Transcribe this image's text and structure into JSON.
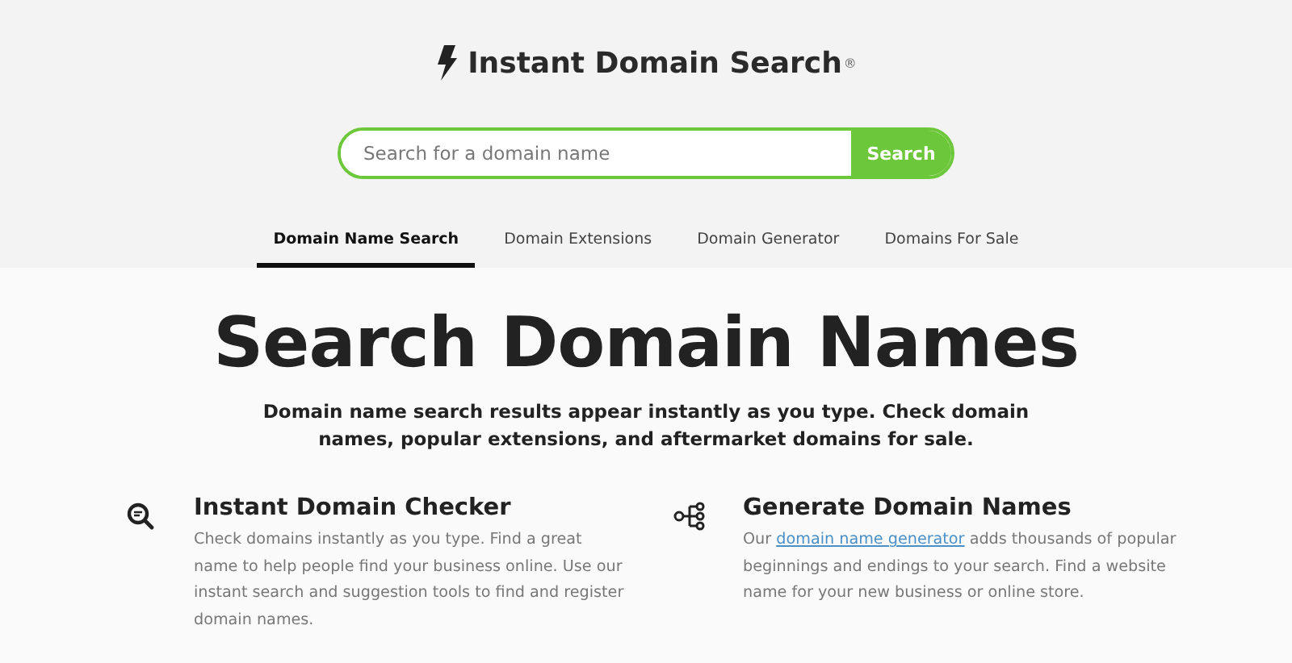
{
  "logo": {
    "text": "Instant Domain Search",
    "mark": "®"
  },
  "search": {
    "placeholder": "Search for a domain name",
    "button": "Search"
  },
  "tabs": [
    {
      "label": "Domain Name Search",
      "selected": true
    },
    {
      "label": "Domain Extensions",
      "selected": false
    },
    {
      "label": "Domain Generator",
      "selected": false
    },
    {
      "label": "Domains For Sale",
      "selected": false
    }
  ],
  "heading": "Search Domain Names",
  "intro": "Domain name search results appear instantly as you type. Check domain names, popular extensions, and aftermarket domains for sale.",
  "features": [
    {
      "kind": "checker",
      "title": "Instant Domain Checker",
      "description": [
        {
          "kind": "text",
          "text": "Check domains instantly as you type. Find a great name to help people find your business online. Use our instant search and suggestion tools to find and register domain names."
        }
      ]
    },
    {
      "kind": "generator",
      "title": "Generate Domain Names",
      "description": [
        {
          "kind": "text",
          "text": "Our "
        },
        {
          "kind": "link",
          "text": "domain name generator"
        },
        {
          "kind": "text",
          "text": " adds thousands of popular beginnings and endings to your search. Find a website name for your new business or online store."
        }
      ]
    }
  ]
}
